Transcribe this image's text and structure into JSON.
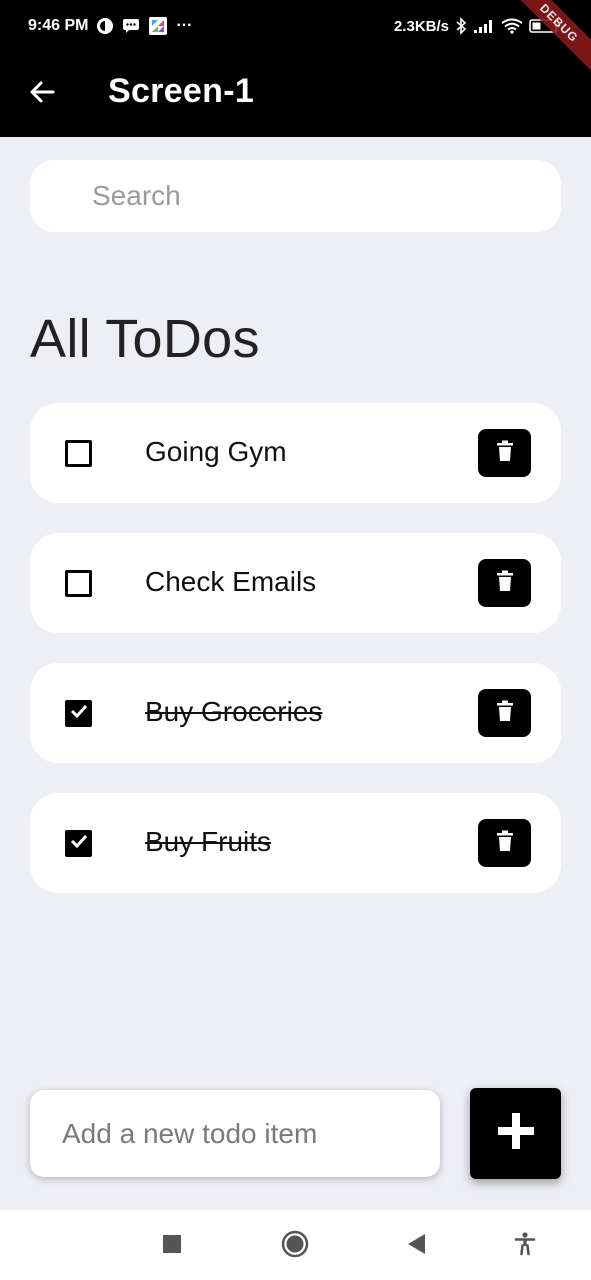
{
  "status_bar": {
    "time": "9:46 PM",
    "more": "···",
    "net_speed": "2.3KB/s"
  },
  "app_bar": {
    "title": "Screen-1",
    "debug_banner": "DEBUG"
  },
  "search": {
    "placeholder": "Search",
    "value": ""
  },
  "section": {
    "title": "All ToDos"
  },
  "todos": [
    {
      "text": "Going Gym",
      "done": false
    },
    {
      "text": "Check Emails",
      "done": false
    },
    {
      "text": "Buy Groceries",
      "done": true
    },
    {
      "text": "Buy Fruits",
      "done": true
    }
  ],
  "add_todo": {
    "placeholder": "Add a new todo item",
    "value": ""
  },
  "icons": {
    "back": "arrow-left-icon",
    "delete": "trash-icon",
    "add": "plus-icon",
    "check": "checkmark-icon",
    "nav_recents": "square-icon",
    "nav_home": "circle-icon",
    "nav_back": "triangle-left-icon",
    "nav_accessibility": "accessibility-icon"
  },
  "colors": {
    "background": "#EEEFF5",
    "app_bar": "#000000",
    "card": "#FFFFFF",
    "accent": "#000000",
    "debug_banner": "#8B1A1A"
  }
}
